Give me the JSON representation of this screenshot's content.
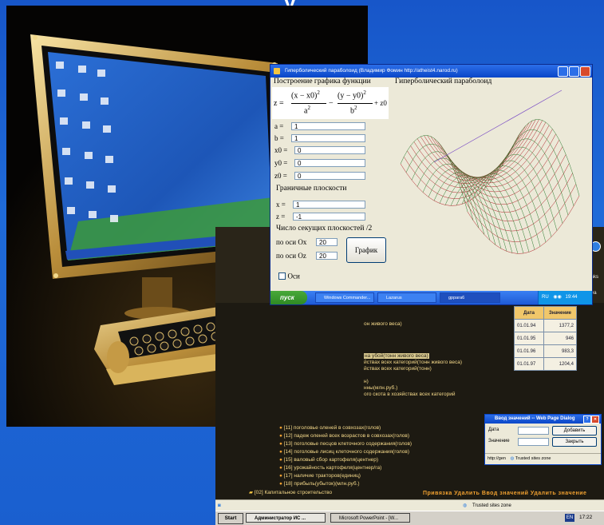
{
  "title_fragment": "у",
  "paraboloid_window": {
    "title": "Гиперболический параболоид (Владимир Фомин http://atheist4.narod.ru)",
    "heading": "Построение графика функции",
    "plot_title": "Гиперболический параболоид",
    "formula": {
      "lhs": "z =",
      "term1_num": "(x − x0)",
      "term1_den": "a",
      "term2_num": "(y − y0)",
      "term2_den": "b",
      "exp": "2",
      "minus": "−",
      "tail": "+ z0"
    },
    "params": [
      {
        "label": "a =",
        "value": "1"
      },
      {
        "label": "b =",
        "value": "1"
      },
      {
        "label": "x0 =",
        "value": "0"
      },
      {
        "label": "y0 =",
        "value": "0"
      },
      {
        "label": "z0 =",
        "value": "0"
      }
    ],
    "boundary_heading": "Граничные плоскости",
    "boundary": [
      {
        "label": "x =",
        "value": "1"
      },
      {
        "label": "z =",
        "value": "-1"
      }
    ],
    "planes_heading": "Число секущих плоскостей /2",
    "planes": [
      {
        "label": "по оси Ox",
        "value": "20"
      },
      {
        "label": "по оси Oz",
        "value": "20"
      }
    ],
    "plot_button": "График",
    "axes_checkbox": "Оси",
    "taskbar": {
      "start": "пуск",
      "items": [
        "Windows Commander...",
        "Lazarus",
        "gppara6"
      ],
      "lang": "RU",
      "clock": "19:44"
    }
  },
  "db_window": {
    "links_label": "Links",
    "side_text": "ауа",
    "table": {
      "headers": [
        "Дата",
        "Значение"
      ],
      "rows": [
        [
          "01.01.94",
          "1377,2"
        ],
        [
          "01.01.95",
          "946"
        ],
        [
          "01.01.96",
          "983,3"
        ],
        [
          "01.01.97",
          "1204,4"
        ]
      ]
    },
    "upper_fragments": [
      "он живого веса)",
      "на убой(тонн живого веса)",
      "йствах всех категорий(тонн живого веса)",
      "йствах всех категорий(тонн)",
      "н)",
      "нны(млн.руб.)",
      "ого скота в хозяйствах всех категорий"
    ],
    "list_items": [
      "[11] поголовье оленей в совхозах(голов)",
      "[12] падеж оленей всех возрастов в совхозах(голов)",
      "[13] поголовье песцов клеточного содержания(голов)",
      "[14] поголовье лисиц клеточного содержания(голов)",
      "[15] валовый сбор картофеля(центнер)",
      "[16] урожайность картофеля(центнер/га)",
      "[17] наличие тракторов(единиц)",
      "[18] прибыль(убыток)(млн.руб.)"
    ],
    "folder_item": "[02] Капитальное строительство",
    "footer_links": "Привязка Удалить Ввод значений Удалить значение",
    "dialog": {
      "title": "Ввод значений -- Web Page Dialog",
      "date_label": "Дата",
      "value_label": "Значение",
      "add_button": "Добавить",
      "close_button": "Закрыть",
      "status_url": "http://gen",
      "status_zone": "Trusted sites zone"
    },
    "status_zone": "Trusted sites zone",
    "taskbar": {
      "start": "Start",
      "items": [
        "Администратор ИС ...",
        "Microsoft PowerPoint - [W..."
      ],
      "lang": "EN",
      "clock": "17:22"
    }
  },
  "colors": {
    "background": "#1a5fcf",
    "xp_title": "#0a46c8",
    "surface_red": "#b0232a",
    "surface_green": "#2e7d32"
  }
}
